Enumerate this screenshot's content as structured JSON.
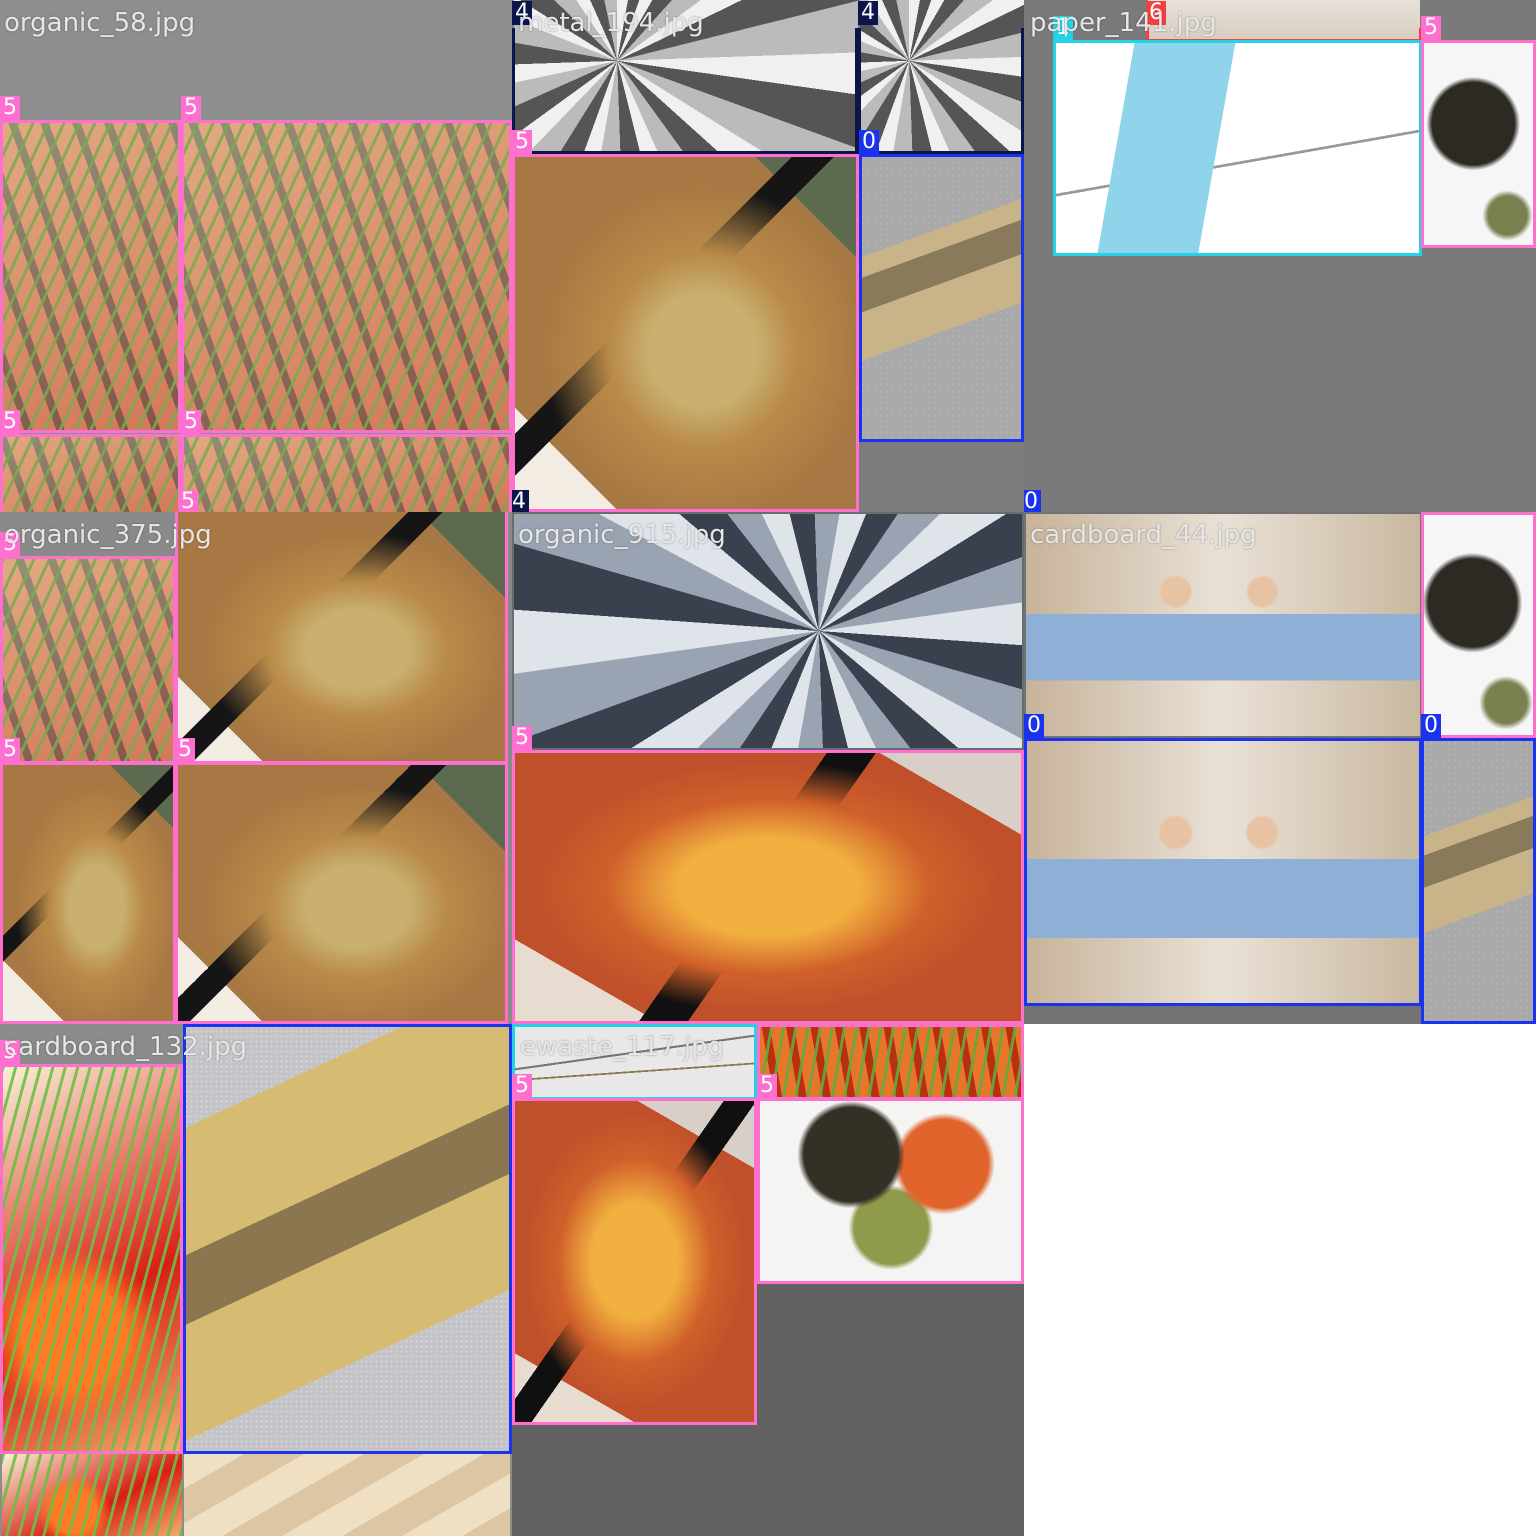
{
  "colors": {
    "label_0": "#1a33ee",
    "label_1": "#22d3e8",
    "label_4": "#0b154a",
    "label_5": "#ff6fd0",
    "label_6": "#f04040"
  },
  "cells": [
    {
      "name": "organic_58.jpg",
      "bg": "#8e8e8e",
      "tiles": [
        {
          "texture": "t-carrot"
        },
        {
          "texture": "t-carrot"
        },
        {
          "texture": "t-carrot"
        },
        {
          "texture": "t-carrot"
        }
      ],
      "boxes": [
        {
          "label": "5"
        },
        {
          "label": "5"
        },
        {
          "label": "5"
        },
        {
          "label": "5"
        },
        {
          "label": "5"
        }
      ]
    },
    {
      "name": "metal_194.jpg",
      "bg": "#7c7c7c",
      "tiles": [
        {
          "texture": "t-metal"
        },
        {
          "texture": "t-metal"
        },
        {
          "texture": "t-lasagna"
        },
        {
          "texture": "t-cardboard"
        }
      ],
      "boxes": [
        {
          "label": "4"
        },
        {
          "label": "4"
        },
        {
          "label": "5"
        },
        {
          "label": "0"
        },
        {
          "label": "4"
        }
      ]
    },
    {
      "name": "paper_141.jpg",
      "bg": "#7a7a7a",
      "tiles": [
        {
          "texture": "t-paper"
        },
        {
          "texture": "t-capacitor"
        },
        {
          "texture": "t-lentil2"
        }
      ],
      "boxes": [
        {
          "label": "6"
        },
        {
          "label": "1"
        },
        {
          "label": "5"
        },
        {
          "label": "0"
        }
      ]
    },
    {
      "name": "organic_375.jpg",
      "bg": "#8a8a8a",
      "tiles": [
        {
          "texture": "t-carrot"
        },
        {
          "texture": "t-lasagna"
        },
        {
          "texture": "t-lasagna"
        },
        {
          "texture": "t-lasagna"
        }
      ],
      "boxes": [
        {
          "label": "5"
        },
        {
          "label": "5"
        },
        {
          "label": "5"
        },
        {
          "label": "5"
        }
      ]
    },
    {
      "name": "organic_915.jpg",
      "bg": "#6c6c6c",
      "tiles": [
        {
          "texture": "t-metal2"
        },
        {
          "texture": "t-lasagna2"
        }
      ],
      "boxes": [
        {
          "label": "5"
        }
      ]
    },
    {
      "name": "cardboard_44.jpg",
      "bg": "#727272",
      "tiles": [
        {
          "texture": "t-couple"
        },
        {
          "texture": "t-lentil2"
        },
        {
          "texture": "t-couple"
        },
        {
          "texture": "t-cardboard"
        }
      ],
      "boxes": [
        {
          "label": "5"
        },
        {
          "label": "0"
        },
        {
          "label": "0"
        }
      ]
    },
    {
      "name": "cardboard_132.jpg",
      "bg": "#8c8c8c",
      "tiles": [
        {
          "texture": "t-carrot2"
        },
        {
          "texture": "t-cardboard2"
        },
        {
          "texture": "t-carrot2"
        },
        {
          "texture": "t-cloth"
        }
      ],
      "boxes": [
        {
          "label": "5"
        },
        {
          "label": "0"
        }
      ]
    },
    {
      "name": "ewaste_117.jpg",
      "bg": "#616161",
      "tiles": [
        {
          "texture": "t-wires"
        },
        {
          "texture": "t-carrot3"
        },
        {
          "texture": "t-lasagna2"
        },
        {
          "texture": "t-lentil"
        }
      ],
      "boxes": [
        {
          "label": "1"
        },
        {
          "label": "5"
        },
        {
          "label": "5"
        },
        {
          "label": "5"
        }
      ]
    }
  ]
}
